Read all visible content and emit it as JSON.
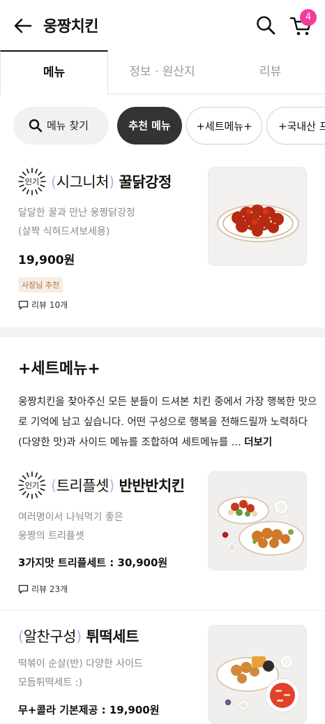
{
  "header": {
    "title": "웅짱치킨",
    "cart_count": "4",
    "icons": [
      "back-arrow-icon",
      "search-icon",
      "cart-icon"
    ]
  },
  "tabs": [
    {
      "label": "메뉴",
      "active": true
    },
    {
      "label": "정보 · 원산지",
      "active": false
    },
    {
      "label": "리뷰",
      "active": false
    }
  ],
  "chips": {
    "search": "메뉴 찾기",
    "recommended": "추천 메뉴",
    "set_menu": "+세트메뉴+",
    "domestic": "+국내산 프"
  },
  "popular_label": "인기",
  "items": [
    {
      "popular": true,
      "bracket_text": "시그니처",
      "name": "꿀닭강정",
      "desc": [
        "달달한 꿀과 만난 웅짱닭강정",
        "(살짝 식혀드셔보세용)"
      ],
      "price": "19,900원",
      "tag": "사장님 추천",
      "reviews": "리뷰 10개"
    },
    {
      "popular": true,
      "bracket_text": "트리플셋",
      "name": "반반반치킨",
      "desc": [
        "여러명이서 나눠먹기 좋은",
        "웅짱의 트리플셋"
      ],
      "price": "3가지맛 트리플세트 : 30,900원",
      "reviews": "리뷰 23개"
    },
    {
      "popular": false,
      "bracket_text": "알찬구성",
      "name": "튀떡세트",
      "desc": [
        "떡볶이 순살(반) 다양한 사이드",
        "모듬튀떡세트 :)"
      ],
      "price": "무+콜라 기본제공 : 19,900원"
    }
  ],
  "section": {
    "title": "+세트메뉴+",
    "desc": "웅짱치킨을 찾아주신 모든 분들이 드셔본 치킨 중에서 가장 행복한 맛으로 기억에 남고 싶습니다. 어떤 구성으로 행복을 전해드릴까 노력하다 (다양한 맛)과 사이드 메뉴를 조합하여 세트메뉴를 ...",
    "more": "더보기"
  },
  "colors": {
    "accent_pink": "#f03d9a",
    "bracket_purple": "#c9a8f0",
    "chip_dark": "#333333",
    "tag_bg": "#f7ece2"
  }
}
